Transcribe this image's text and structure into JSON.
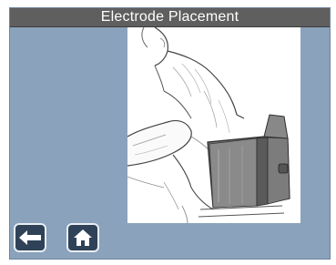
{
  "header": {
    "title": "Electrode Placement"
  },
  "illustration": {
    "subject": "Torso with back electrode pad"
  },
  "nav": {
    "back_icon": "arrow-left-icon",
    "home_icon": "home-icon"
  },
  "colors": {
    "background": "#8aa2bb",
    "title_bar": "#5f5f5f",
    "button": "#2f4257",
    "pad": "#7a7a7a"
  }
}
